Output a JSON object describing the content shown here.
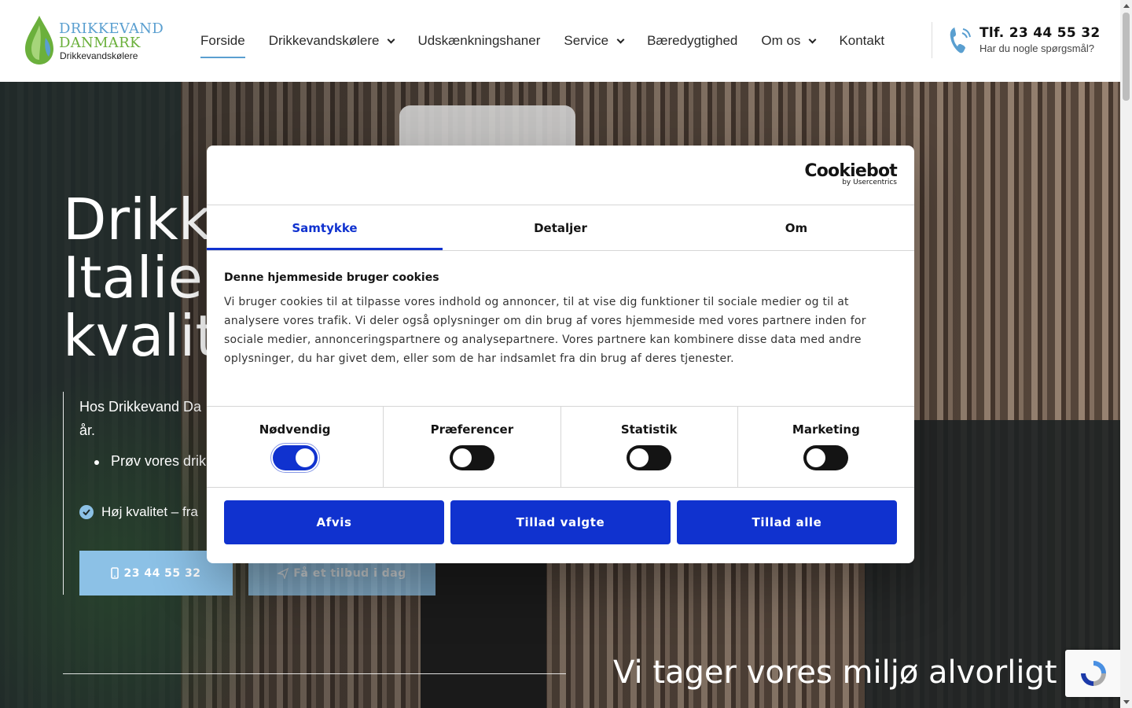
{
  "header": {
    "logo": {
      "line1": "Drikkevand",
      "line2": "Danmark",
      "line3": "Drikkevandskølere"
    },
    "nav": [
      {
        "label": "Forside",
        "active": true,
        "dropdown": false
      },
      {
        "label": "Drikkevandskølere",
        "active": false,
        "dropdown": true
      },
      {
        "label": "Udskænkningshaner",
        "active": false,
        "dropdown": false
      },
      {
        "label": "Service",
        "active": false,
        "dropdown": true
      },
      {
        "label": "Bæredygtighed",
        "active": false,
        "dropdown": false
      },
      {
        "label": "Om os",
        "active": false,
        "dropdown": true
      },
      {
        "label": "Kontakt",
        "active": false,
        "dropdown": false
      }
    ],
    "phone": "Tlf. 23 44 55 32",
    "phone_question": "Har du nogle spørgsmål?"
  },
  "hero": {
    "title_lines": [
      "Drikk",
      "Italie",
      "kvalit"
    ],
    "intro": "Hos Drikkevand Da år.",
    "bullet": "Prøv vores drik",
    "check_text": "Høj kvalitet – fra",
    "btn_call": "23 44 55 32",
    "btn_offer": "Få et tilbud i dag",
    "environment_heading": "Vi tager vores miljø alvorligt"
  },
  "cookie_dialog": {
    "brand": "Cookiebot",
    "brand_sub": "by Usercentrics",
    "tabs": [
      "Samtykke",
      "Detaljer",
      "Om"
    ],
    "active_tab": "Samtykke",
    "heading": "Denne hjemmeside bruger cookies",
    "text": "Vi bruger cookies til at tilpasse vores indhold og annoncer, til at vise dig funktioner til sociale medier og til at analysere vores trafik. Vi deler også oplysninger om din brug af vores hjemmeside med vores partnere inden for sociale medier, annonceringspartnere og analysepartnere. Vores partnere kan kombinere disse data med andre oplysninger, du har givet dem, eller som de har indsamlet fra din brug af deres tjenester.",
    "categories": [
      {
        "label": "Nødvendig",
        "enabled": true
      },
      {
        "label": "Præferencer",
        "enabled": false
      },
      {
        "label": "Statistik",
        "enabled": false
      },
      {
        "label": "Marketing",
        "enabled": false
      }
    ],
    "buttons": {
      "reject": "Afvis",
      "allow_selected": "Tillad valgte",
      "allow_all": "Tillad alle"
    }
  },
  "colors": {
    "accent": "#1032cf",
    "brand_blue": "#5a9fd0",
    "brand_green": "#6bb03c",
    "hero_button": "#8cc1e6"
  },
  "icons": {
    "phone": "phone-icon",
    "mobile": "mobile-icon",
    "send": "send-icon",
    "check": "check-circle-icon",
    "recaptcha": "recaptcha-icon"
  }
}
